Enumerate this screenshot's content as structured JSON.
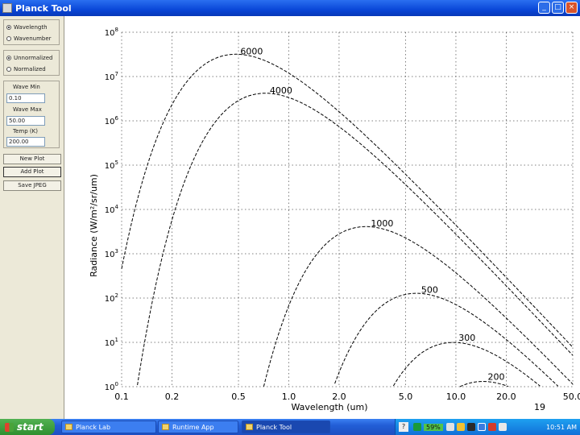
{
  "window": {
    "title": "Planck Tool",
    "buttons": [
      "_",
      "□",
      "×"
    ]
  },
  "panel": {
    "mode_options": [
      {
        "label": "Wavelength",
        "selected": true
      },
      {
        "label": "Wavenumber",
        "selected": false
      }
    ],
    "norm_options": [
      {
        "label": "Unnormalized",
        "selected": true
      },
      {
        "label": "Normalized",
        "selected": false
      }
    ],
    "wave_min": {
      "label": "Wave Min",
      "value": "0.10"
    },
    "wave_max": {
      "label": "Wave Max",
      "value": "50.00"
    },
    "temp": {
      "label": "Temp (K)",
      "value": "200.00"
    },
    "buttons": {
      "new_plot": "New Plot",
      "add_plot": "Add Plot",
      "save_jpeg": "Save JPEG"
    }
  },
  "chart_data": {
    "type": "line",
    "xlabel": "Wavelength (um)",
    "ylabel": "Radiance (W/m²/sr/um)",
    "xscale": "log",
    "yscale": "log",
    "xlim": [
      0.1,
      50.0
    ],
    "ylim": [
      1,
      100000000
    ],
    "grid": true,
    "x_ticks": [
      "0.1",
      "0.2",
      "0.5",
      "1.0",
      "2.0",
      "5.0",
      "10.0",
      "20.0",
      "50.0"
    ],
    "y_ticks": [
      {
        "base": "10",
        "exp": "0"
      },
      {
        "base": "10",
        "exp": "1"
      },
      {
        "base": "10",
        "exp": "2"
      },
      {
        "base": "10",
        "exp": "3"
      },
      {
        "base": "10",
        "exp": "4"
      },
      {
        "base": "10",
        "exp": "5"
      },
      {
        "base": "10",
        "exp": "6"
      },
      {
        "base": "10",
        "exp": "7"
      },
      {
        "base": "10",
        "exp": "8"
      }
    ],
    "series": [
      {
        "name": "6000",
        "temperature_k": 6000,
        "peak": {
          "x": 0.48,
          "y": 29000000
        }
      },
      {
        "name": "4000",
        "temperature_k": 4000,
        "peak": {
          "x": 0.72,
          "y": 3800000
        }
      },
      {
        "name": "1000",
        "temperature_k": 1000,
        "peak": {
          "x": 2.9,
          "y": 3800
        }
      },
      {
        "name": "500",
        "temperature_k": 500,
        "peak": {
          "x": 5.8,
          "y": 120
        }
      },
      {
        "name": "300",
        "temperature_k": 300,
        "peak": {
          "x": 9.7,
          "y": 10
        }
      },
      {
        "name": "200",
        "temperature_k": 200,
        "peak": {
          "x": 14.5,
          "y": 1.3
        }
      }
    ]
  },
  "page_number": "19",
  "taskbar": {
    "start_label": "start",
    "tasks": [
      {
        "label": "Planck Lab"
      },
      {
        "label": "Runtime App"
      },
      {
        "label": "Planck Tool",
        "active": true
      }
    ],
    "battery": "59%",
    "clock": "10:51 AM"
  }
}
